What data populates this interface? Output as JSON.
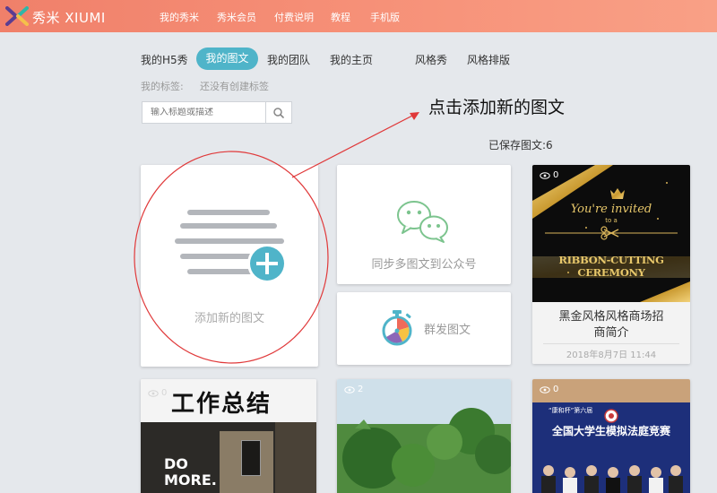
{
  "header": {
    "brand": "秀米 XIUMI",
    "nav": [
      "我的秀米",
      "秀米会员",
      "付费说明",
      "教程",
      "手机版"
    ]
  },
  "tabs": {
    "h5": "我的H5秀",
    "article": "我的图文",
    "team": "我的团队",
    "home": "我的主页",
    "style_show": "风格秀",
    "style_layout": "风格排版"
  },
  "tags": {
    "label": "我的标签:",
    "empty": "还没有创建标签"
  },
  "search": {
    "placeholder": "输入标题或描述"
  },
  "callout": "点击添加新的图文",
  "saved": "已保存图文:6",
  "cards": {
    "add": "添加新的图文",
    "sync": "同步多图文到公众号",
    "mass": "群发图文",
    "ribbon": {
      "views": "0",
      "img_script": "You're invited",
      "img_to": "to a",
      "img_headline": "RIBBON-CUTTING CEREMONY",
      "title_line1": "黑金风格风格商场招",
      "title_line2": "商简介",
      "date": "2018年8月7日 11:44"
    },
    "b1": {
      "views": "0",
      "headline": "工作总结",
      "sign": "DO MORE."
    },
    "b2": {
      "views": "2"
    },
    "b3": {
      "views": "0",
      "top": "“康和杯”第六届",
      "headline": "全国大学生模拟法庭竞赛"
    }
  },
  "colors": {
    "header_start": "#f0806a",
    "accent_teal": "#4fb4c9",
    "annotation_red": "#e0393a"
  }
}
